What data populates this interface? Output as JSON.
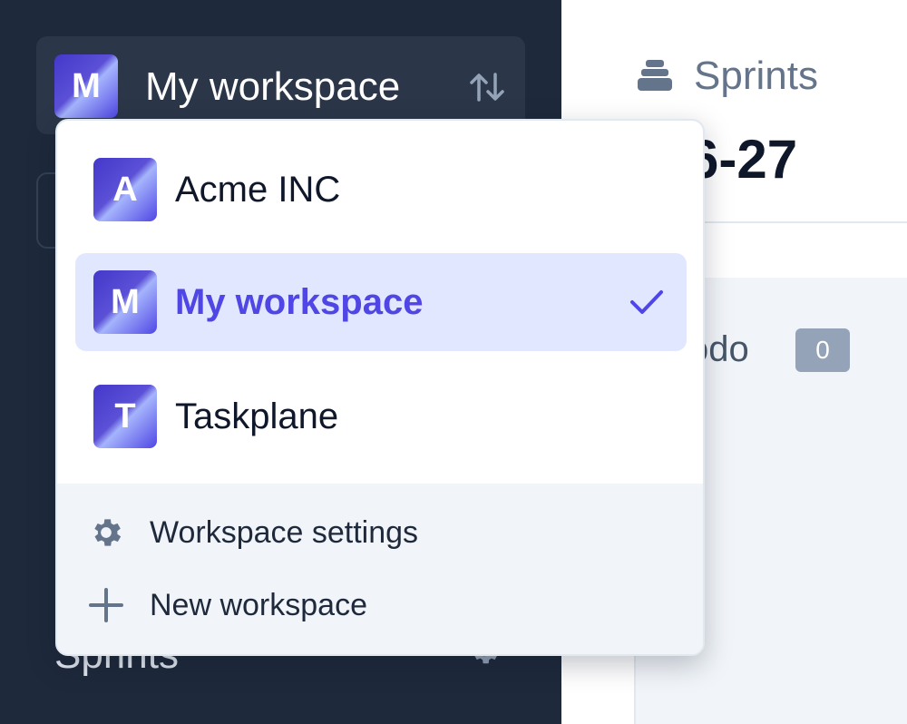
{
  "sidebar": {
    "current_workspace": {
      "initial": "M",
      "name": "My workspace"
    },
    "section_label": "Sprints"
  },
  "main": {
    "header_title": "Sprints",
    "sprint_range": "6-27",
    "column": {
      "title": "odo",
      "count": "0"
    }
  },
  "dropdown": {
    "workspaces": [
      {
        "initial": "A",
        "name": "Acme INC",
        "selected": false
      },
      {
        "initial": "M",
        "name": "My workspace",
        "selected": true
      },
      {
        "initial": "T",
        "name": "Taskplane",
        "selected": false
      }
    ],
    "footer": {
      "settings_label": "Workspace settings",
      "new_label": "New workspace"
    }
  },
  "colors": {
    "sidebar_bg": "#1e293b",
    "accent": "#4f46e5",
    "selected_bg": "#e0e7ff",
    "footer_bg": "#f1f5f9",
    "badge_bg": "#94a3b8"
  },
  "icons": [
    "swap-vertical-icon",
    "stack-icon",
    "check-icon",
    "gear-icon",
    "plus-icon"
  ]
}
